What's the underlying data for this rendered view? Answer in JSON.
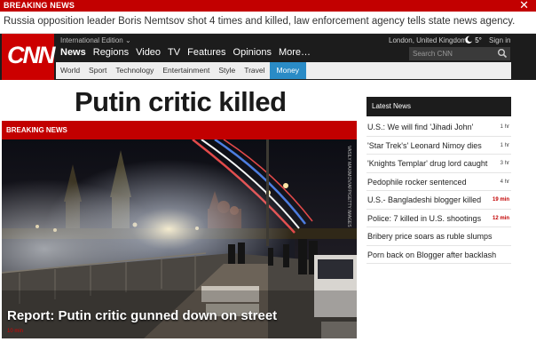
{
  "breaking": {
    "label": "BREAKING NEWS",
    "text": "Russia opposition leader Boris Nemtsov shot 4 times and killed, law enforcement agency tells state news agency.",
    "close_glyph": "✕"
  },
  "header": {
    "logo": "CNN",
    "edition": "International Edition ⌄",
    "nav": [
      "News",
      "Regions",
      "Video",
      "TV",
      "Features",
      "Opinions",
      "More…"
    ],
    "location": "London, United Kingdom",
    "weather": "5°",
    "signin": "Sign in",
    "search_placeholder": "Search CNN"
  },
  "subnav": [
    "World",
    "Sport",
    "Technology",
    "Entertainment",
    "Style",
    "Travel",
    "Money"
  ],
  "headline": "Putin critic killed",
  "card": {
    "label": "BREAKING NEWS",
    "caption": "Report: Putin critic gunned down on street",
    "time": "10 min",
    "credit": "VASILY MAXIMOV/AFP/GETTY IMAGES"
  },
  "latest": {
    "title": "Latest News",
    "items": [
      {
        "text": "U.S.: We will find 'Jihadi John'",
        "time": "1 hr",
        "red": false
      },
      {
        "text": "'Star Trek's' Leonard Nimoy dies",
        "time": "1 hr",
        "red": false
      },
      {
        "text": "'Knights Templar' drug lord caught",
        "time": "3 hr",
        "red": false
      },
      {
        "text": "Pedophile rocker sentenced",
        "time": "4 hr",
        "red": false
      },
      {
        "text": "U.S.- Bangladeshi blogger killed",
        "time": "19 min",
        "red": true
      },
      {
        "text": "Police: 7 killed in U.S. shootings",
        "time": "12 min",
        "red": true
      },
      {
        "text": "Bribery price soars as ruble slumps",
        "time": "",
        "red": false
      },
      {
        "text": "Porn back on Blogger after backlash",
        "time": "",
        "red": false
      }
    ]
  },
  "colors": {
    "brand_red": "#cc0000",
    "breaking_red": "#c20000",
    "money_blue": "#2a8bc6"
  }
}
